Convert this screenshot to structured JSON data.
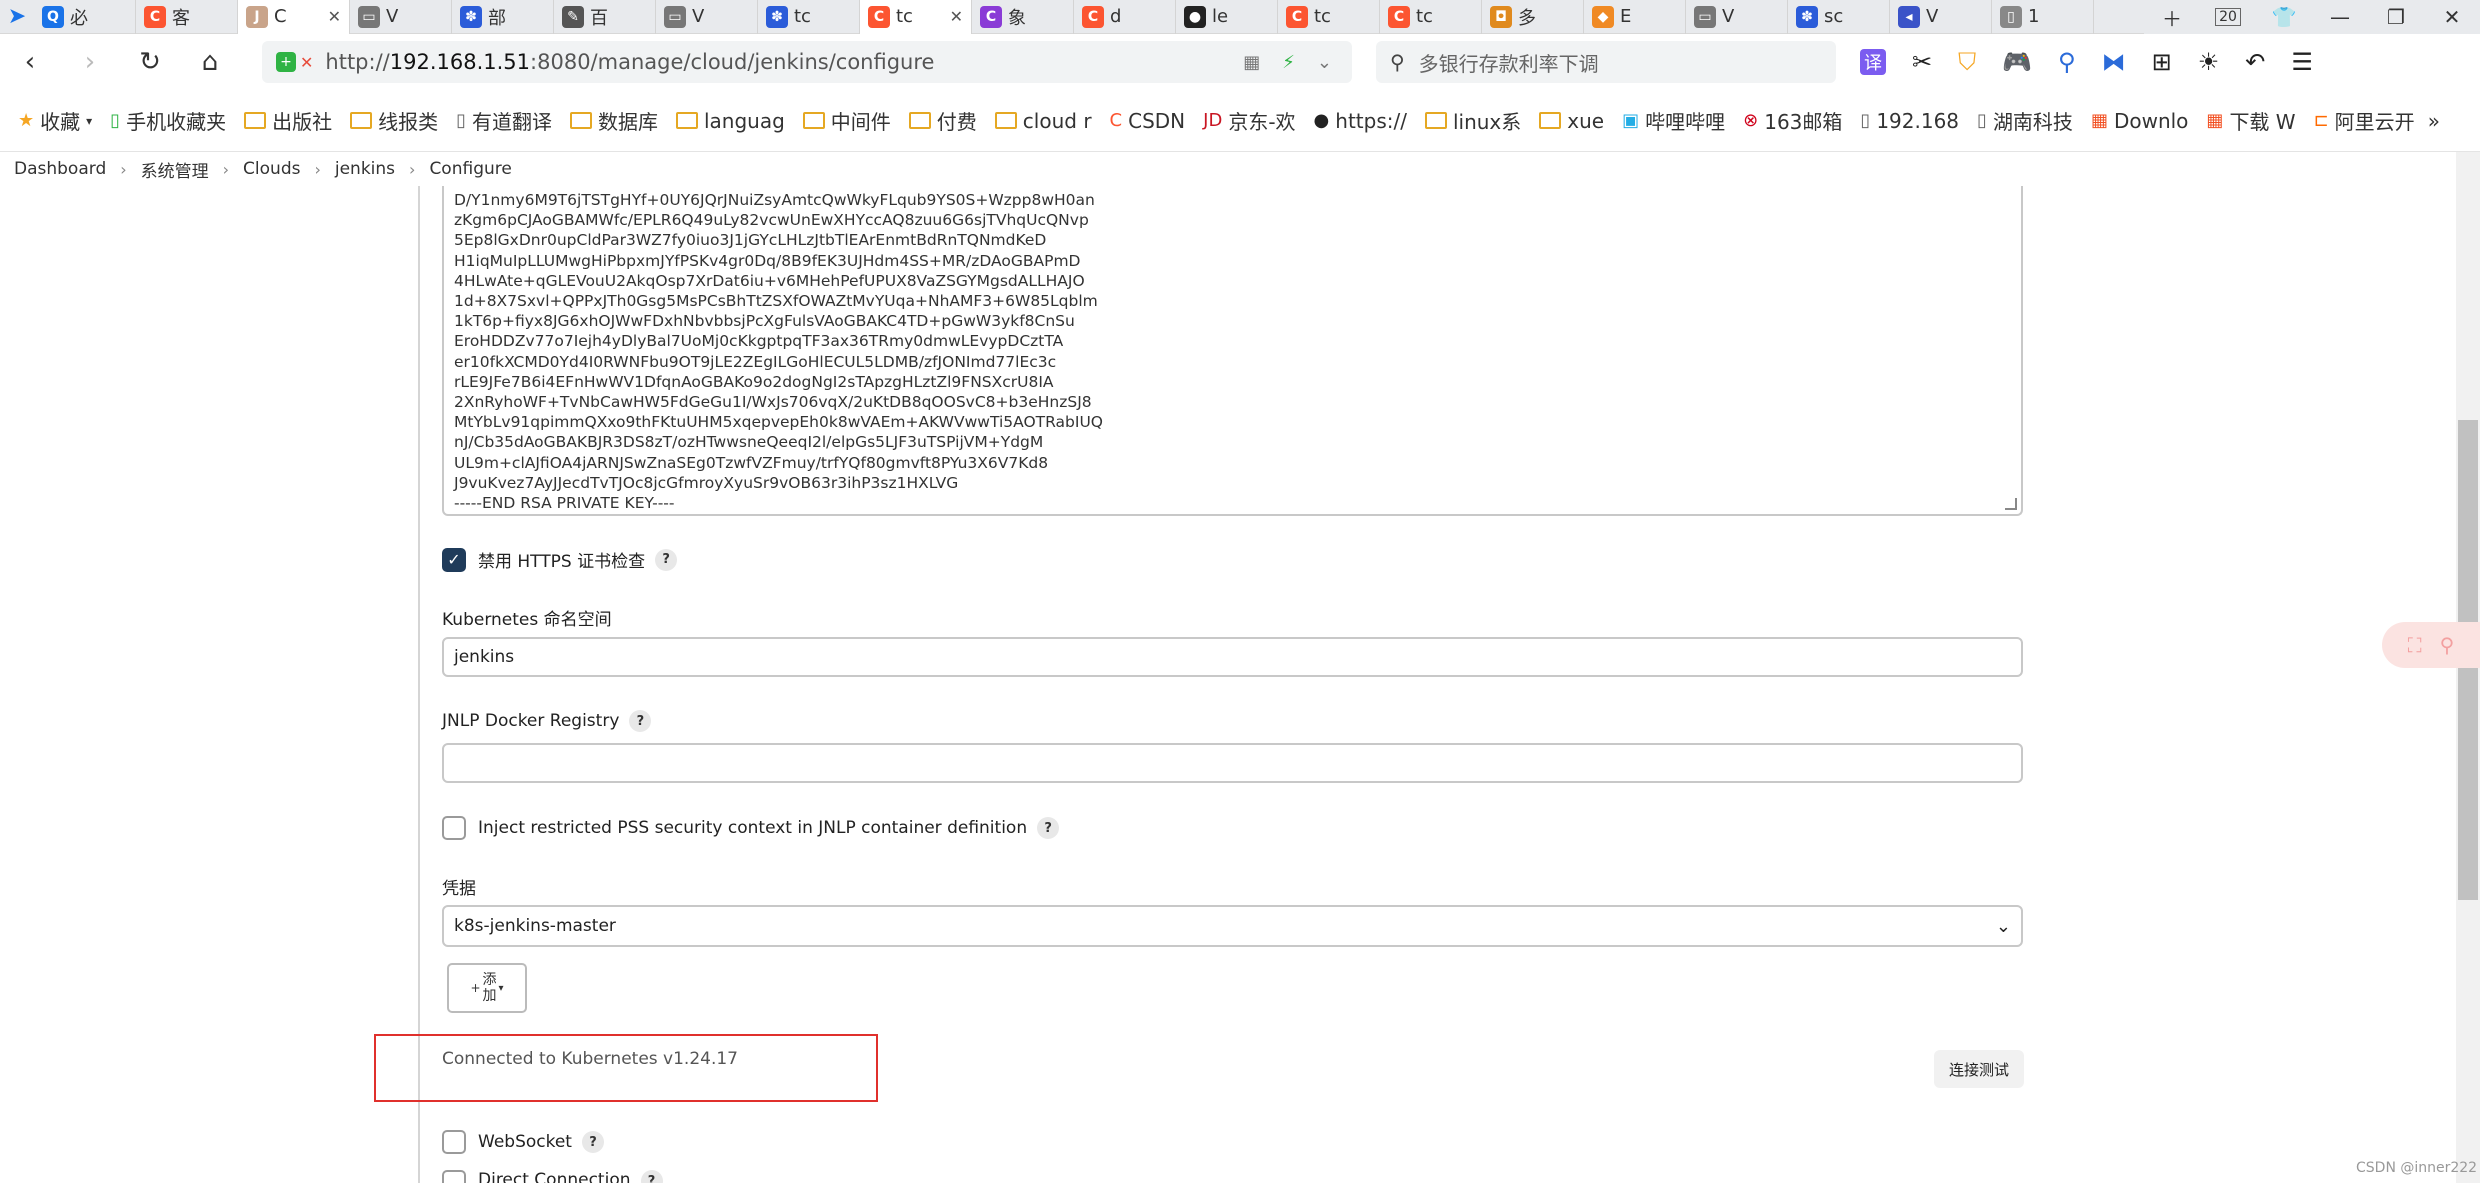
{
  "tabs": [
    {
      "label": "必",
      "icon": "search-icon",
      "color": "#1a73e8",
      "glyph": "Q"
    },
    {
      "label": "客",
      "icon": "csdn-icon",
      "color": "#fc5531",
      "glyph": "C"
    },
    {
      "label": "C",
      "icon": "jenkins-icon",
      "color": "#c9a48a",
      "glyph": "J",
      "active": true
    },
    {
      "label": "V",
      "icon": "page-icon",
      "color": "#777",
      "glyph": "▭"
    },
    {
      "label": "部",
      "icon": "baidu-icon",
      "color": "#2b5cd9",
      "glyph": "✽"
    },
    {
      "label": "百",
      "icon": "script-icon",
      "color": "#555",
      "glyph": "✎"
    },
    {
      "label": "V",
      "icon": "page-icon",
      "color": "#777",
      "glyph": "▭"
    },
    {
      "label": "tc",
      "icon": "baidu-icon",
      "color": "#2b5cd9",
      "glyph": "✽"
    },
    {
      "label": "tc",
      "icon": "csdn-icon",
      "color": "#fc5531",
      "glyph": "C",
      "active": true
    },
    {
      "label": "象",
      "icon": "c-icon",
      "color": "#8a3bd6",
      "glyph": "C"
    },
    {
      "label": "d",
      "icon": "csdn-icon",
      "color": "#fc5531",
      "glyph": "C"
    },
    {
      "label": "le",
      "icon": "github-icon",
      "color": "#222",
      "glyph": "●"
    },
    {
      "label": "tc",
      "icon": "csdn-icon",
      "color": "#fc5531",
      "glyph": "C"
    },
    {
      "label": "tc",
      "icon": "csdn-icon",
      "color": "#fc5531",
      "glyph": "C"
    },
    {
      "label": "多",
      "icon": "app-icon",
      "color": "#e08a1e",
      "glyph": "◘"
    },
    {
      "label": "E",
      "icon": "cube-icon",
      "color": "#f08a24",
      "glyph": "◆"
    },
    {
      "label": "V",
      "icon": "page-icon",
      "color": "#777",
      "glyph": "▭"
    },
    {
      "label": "sc",
      "icon": "baidu-icon",
      "color": "#2b5cd9",
      "glyph": "✽"
    },
    {
      "label": "V",
      "icon": "arrows-icon",
      "color": "#3a53c8",
      "glyph": "◂"
    },
    {
      "label": "1",
      "icon": "doc-icon",
      "color": "#888",
      "glyph": "▯"
    }
  ],
  "tab_count": "20",
  "url": {
    "scheme": "http://",
    "host": "192.168.1.51",
    "rest": ":8080/manage/cloud/jenkins/configure"
  },
  "search_placeholder": "多银行存款利率下调",
  "bookmarks": [
    {
      "label": "收藏",
      "type": "star"
    },
    {
      "label": "手机收藏夹",
      "type": "phone"
    },
    {
      "label": "出版社",
      "type": "folder"
    },
    {
      "label": "线报类",
      "type": "folder"
    },
    {
      "label": "有道翻译",
      "type": "doc"
    },
    {
      "label": "数据库",
      "type": "folder"
    },
    {
      "label": "languag",
      "type": "folder"
    },
    {
      "label": "中间件",
      "type": "folder"
    },
    {
      "label": "付费",
      "type": "folder"
    },
    {
      "label": "cloud r",
      "type": "folder"
    },
    {
      "label": "CSDN",
      "type": "csdn"
    },
    {
      "label": "京东-欢",
      "type": "jd"
    },
    {
      "label": "https://",
      "type": "github"
    },
    {
      "label": "linux系",
      "type": "folder"
    },
    {
      "label": "xue",
      "type": "folder"
    },
    {
      "label": "哔哩哔哩",
      "type": "bili"
    },
    {
      "label": "163邮箱",
      "type": "mail"
    },
    {
      "label": "192.168",
      "type": "doc"
    },
    {
      "label": "湖南科技",
      "type": "doc"
    },
    {
      "label": "Downlo",
      "type": "ms"
    },
    {
      "label": "下载 W",
      "type": "ms"
    },
    {
      "label": "阿里云开",
      "type": "ali"
    }
  ],
  "breadcrumbs": [
    "Dashboard",
    "系统管理",
    "Clouds",
    "jenkins",
    "Configure"
  ],
  "key_text": "D/Y1nmy6M9T6jTSTgHYf+0UY6JQrJNuiZsyAmtcQwWkyFLqub9YS0S+Wzpp8wH0an\nzKgm6pCJAoGBAMWfc/EPLR6Q49uLy82vcwUnEwXHYccAQ8zuu6G6sjTVhqUcQNvp\n5Ep8lGxDnr0upCldPar3WZ7fy0iuo3J1jGYcLHLzJtbTlEArEnmtBdRnTQNmdKeD\nH1iqMuIpLLUMwgHiPbpxmJYfPSKv4gr0Dq/8B9fEK3UJHdm4SS+MR/zDAoGBAPmD\n4HLwAte+qGLEVouU2AkqOsp7XrDat6iu+v6MHehPefUPUX8VaZSGYMgsdALLHAJO\n1d+8X7Sxvl+QPPxJTh0Gsg5MsPCsBhTtZSXfOWAZtMvYUqa+NhAMF3+6W85Lqblm\n1kT6p+fiyx8JG6xhOJWwFDxhNbvbbsjPcXgFulsVAoGBAKC4TD+pGwW3ykf8CnSu\nEroHDDZv77o7Iejh4yDlyBal7UoMj0cKkgptpqTF3ax36TRmy0dmwLEvypDCztTA\ner10fkXCMD0Yd4I0RWNFbu9OT9jLE2ZEgILGoHlECUL5LDMB/zfJONImd77lEc3c\nrLE9JFe7B6i4EFnHwWV1DfqnAoGBAKo9o2dogNgI2sTApzgHLztZl9FNSXcrU8IA\n2XnRyhoWF+TvNbCawHW5FdGeGu1I/WxJs706vqX/2uKtDB8qOOSvC8+b3eHnzSJ8\nMtYbLv91qpimmQXxo9thFKtuUHM5xqepvepEh0k8wVAEm+AKWVwwTi5AOTRabIUQ\nnJ/Cb35dAoGBAKBJR3DS8zT/ozHTwwsneQeeqI2l/elpGs5LJF3uTSPijVM+YdgM\nUL9m+clAJfiOA4jARNJSwZnaSEg0TzwfVZFmuy/trfYQf80gmvft8PYu3X6V7Kd8\nJ9vuKvez7AyJJecdTvTJOc8jcGfmroyXyuSr9vOB63r3ihP3sz1HXLVG\n-----END RSA PRIVATE KEY----",
  "form": {
    "disable_https_label": "禁用 HTTPS 证书检查",
    "namespace_label": "Kubernetes 命名空间",
    "namespace_value": "jenkins",
    "jnlp_label": "JNLP Docker Registry",
    "jnlp_value": "",
    "pss_label": "Inject restricted PSS security context in JNLP container definition",
    "credentials_label": "凭据",
    "credentials_value": "k8s-jenkins-master",
    "add_label_1": "添",
    "add_label_2": "加",
    "status_text": "Connected to Kubernetes v1.24.17",
    "test_button": "连接测试",
    "websocket_label": "WebSocket",
    "direct_label": "Direct Connection"
  },
  "watermark": "CSDN @inner222"
}
